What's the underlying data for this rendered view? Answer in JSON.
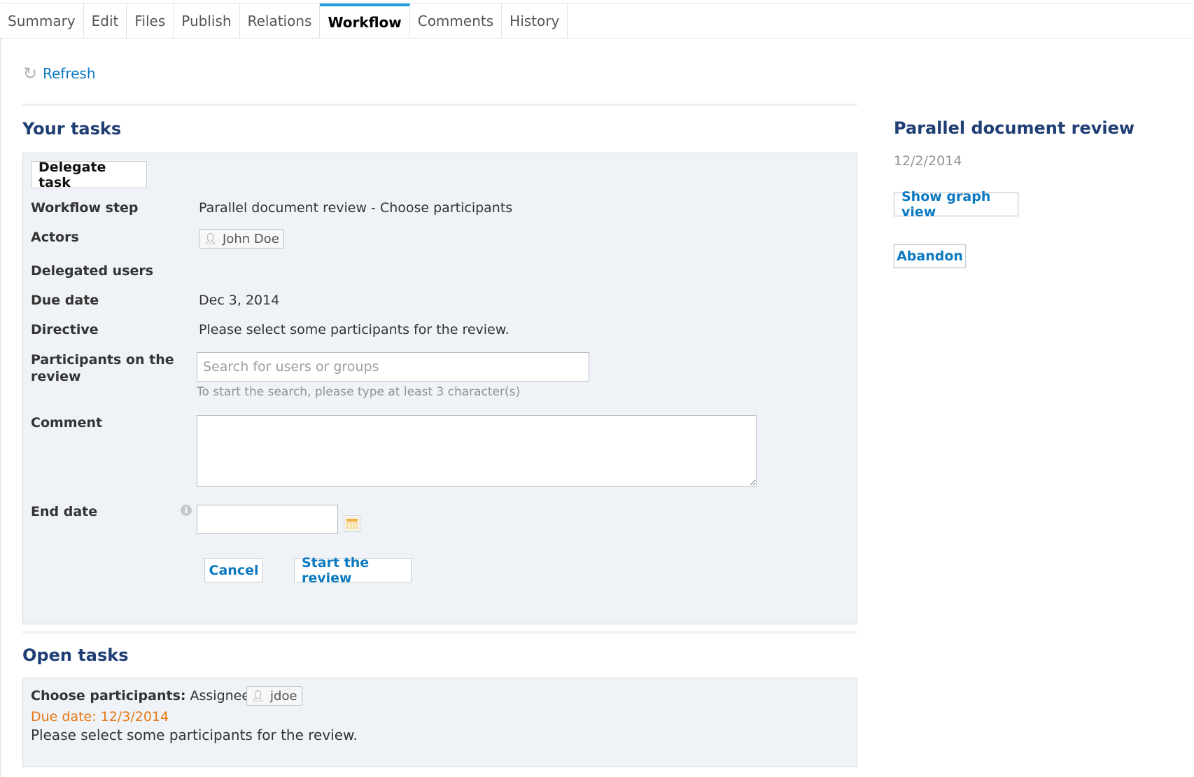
{
  "tabs": [
    {
      "label": "Summary"
    },
    {
      "label": "Edit"
    },
    {
      "label": "Files"
    },
    {
      "label": "Publish"
    },
    {
      "label": "Relations"
    },
    {
      "label": "Workflow"
    },
    {
      "label": "Comments"
    },
    {
      "label": "History"
    }
  ],
  "active_tab": "Workflow",
  "refresh_label": "Refresh",
  "your_tasks": {
    "heading": "Your tasks",
    "delegate_label": "Delegate task",
    "fields": {
      "workflow_step": {
        "label": "Workflow step",
        "value": "Parallel document review - Choose participants"
      },
      "actors": {
        "label": "Actors",
        "chip": "John Doe"
      },
      "delegated_users": {
        "label": "Delegated users"
      },
      "due_date": {
        "label": "Due date",
        "value": "Dec 3, 2014"
      },
      "directive": {
        "label": "Directive",
        "value": "Please select some participants for the review."
      },
      "participants": {
        "label_line1": "Participants on the",
        "label_line2": "review",
        "placeholder": "Search for users or groups",
        "hint": "To start the search, please type at least 3 character(s)"
      },
      "comment": {
        "label": "Comment",
        "value": ""
      },
      "end_date": {
        "label": "End date",
        "value": ""
      }
    },
    "cancel_label": "Cancel",
    "start_label": "Start the review"
  },
  "open_tasks": {
    "heading": "Open tasks",
    "task_label": "Choose participants:",
    "assignees_label": "Assignees",
    "assignee": "jdoe",
    "due_date": "Due date: 12/3/2014",
    "directive": "Please select some participants for the review."
  },
  "side": {
    "title": "Parallel document review",
    "date": "12/2/2014",
    "graph_label": "Show graph view",
    "abandon_label": "Abandon"
  },
  "colors": {
    "accent": "#1e9ee0",
    "heading": "#1f3e74",
    "link": "#0b79c0",
    "due": "#e67812",
    "panel_bg": "#eff2f6"
  }
}
